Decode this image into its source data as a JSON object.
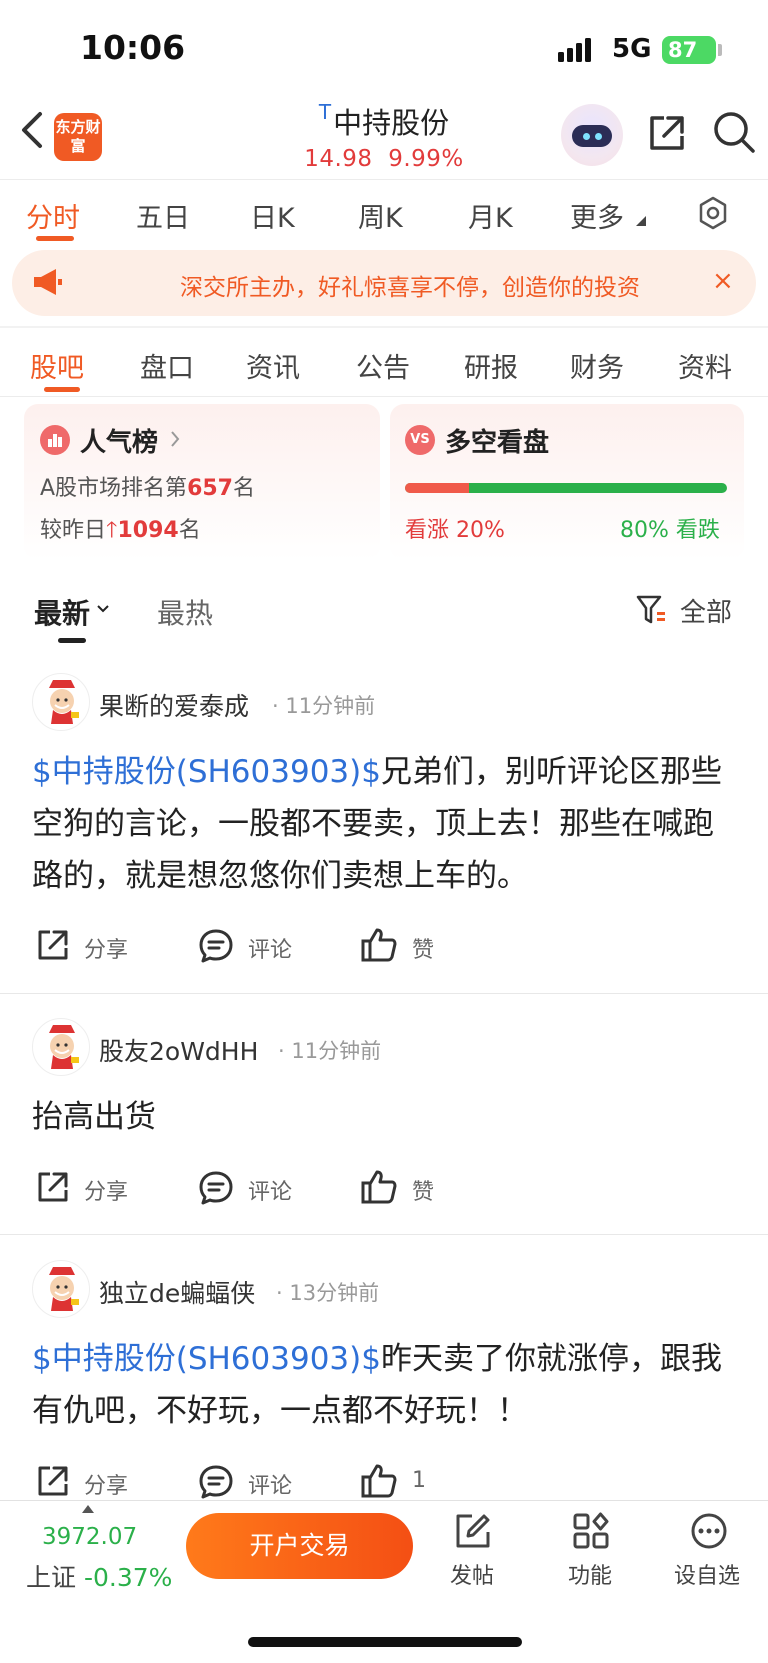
{
  "status_bar": {
    "time": "10:06",
    "network": "5G",
    "battery": "87"
  },
  "header": {
    "logo_text": "东方财富",
    "t_mark": "T",
    "stock_name": "中持股份",
    "price": "14.98",
    "change_pct": "9.99%"
  },
  "chart_tabs": [
    "分时",
    "五日",
    "日K",
    "周K",
    "月K",
    "更多"
  ],
  "banner": {
    "text": "深交所主办，好礼惊喜享不停，创造你的投资",
    "close": "×"
  },
  "section_tabs": [
    "股吧",
    "盘口",
    "资讯",
    "公告",
    "研报",
    "财务",
    "资料"
  ],
  "popularity": {
    "title": "人气榜",
    "rank_prefix": "A股市场排名第",
    "rank": "657",
    "rank_suffix": "名",
    "change_prefix": "较昨日",
    "change_value": "1094",
    "change_suffix": "名"
  },
  "sentiment": {
    "title": "多空看盘",
    "badge": "VS",
    "bull_label": "看涨",
    "bull_pct": "20%",
    "bear_pct": "80%",
    "bear_label": "看跌",
    "bull_fraction": 0.2
  },
  "feed": {
    "tabs": [
      "最新",
      "最热"
    ],
    "filter_label": "全部"
  },
  "posts": [
    {
      "username": "果断的爱泰成",
      "time": "11分钟前",
      "tag": "$中持股份(SH603903)$",
      "body": "兄弟们，别听评论区那些空狗的言论，一股都不要卖，顶上去！那些在喊跑路的，就是想忽悠你们卖想上车的。",
      "share": "分享",
      "comment": "评论",
      "like": "赞"
    },
    {
      "username": "股友2oWdHH",
      "time": "11分钟前",
      "tag": "",
      "body": "抬高出货",
      "share": "分享",
      "comment": "评论",
      "like": "赞"
    },
    {
      "username": "独立de蝙蝠侠",
      "time": "13分钟前",
      "tag": "$中持股份(SH603903)$",
      "body": "昨天卖了你就涨停，跟我有仇吧，不好玩，一点都不好玩！！",
      "share": "分享",
      "comment": "评论",
      "like": "1"
    }
  ],
  "bottom_bar": {
    "index_value": "3972.07",
    "index_name": "上证",
    "index_change": "-0.37%",
    "open_account": "开户交易",
    "nav": [
      "发帖",
      "功能",
      "设自选"
    ]
  },
  "colors": {
    "accent": "#f05a24",
    "up": "#e23b3b",
    "down": "#2bb04a",
    "link": "#2e6fd6"
  }
}
